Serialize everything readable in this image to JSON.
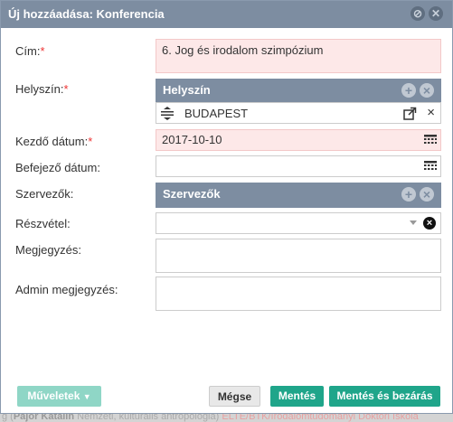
{
  "dialog": {
    "title": "Új hozzáadása: Konferencia",
    "title_buttons": [
      "minimize-icon",
      "close-icon"
    ]
  },
  "form": {
    "cim": {
      "label": "Cím:",
      "required": "*",
      "value": "6. Jog és irodalom szimpózium"
    },
    "helyszin": {
      "label": "Helyszín:",
      "required": "*",
      "panel_title": "Helyszín",
      "items": [
        {
          "name": "BUDAPEST"
        }
      ]
    },
    "kezdo_datum": {
      "label": "Kezdő dátum:",
      "required": "*",
      "value": "2017-10-10"
    },
    "befejezo_datum": {
      "label": "Befejező dátum:",
      "value": ""
    },
    "szervezok": {
      "label": "Szervezők:",
      "panel_title": "Szervezők"
    },
    "reszvetel": {
      "label": "Részvétel:",
      "value": ""
    },
    "megjegyzes": {
      "label": "Megjegyzés:",
      "value": ""
    },
    "admin_megjegyzes": {
      "label": "Admin megjegyzés:",
      "value": ""
    }
  },
  "footer": {
    "muveletek": "Műveletek",
    "megse": "Mégse",
    "mentes": "Mentés",
    "mentes_bezaras": "Mentés és bezárás"
  },
  "background": {
    "bold": "Pajor Katalin",
    "text": "Nemzeti, kulturális antropológia",
    "link": "ELTE/BTK/Irodalomtudományi Doktori Iskola"
  },
  "colors": {
    "header": "#7d8da1",
    "required_bg": "#fde8e8",
    "primary_button": "#1fa58a",
    "muveletek_button": "#8fd6c6"
  }
}
